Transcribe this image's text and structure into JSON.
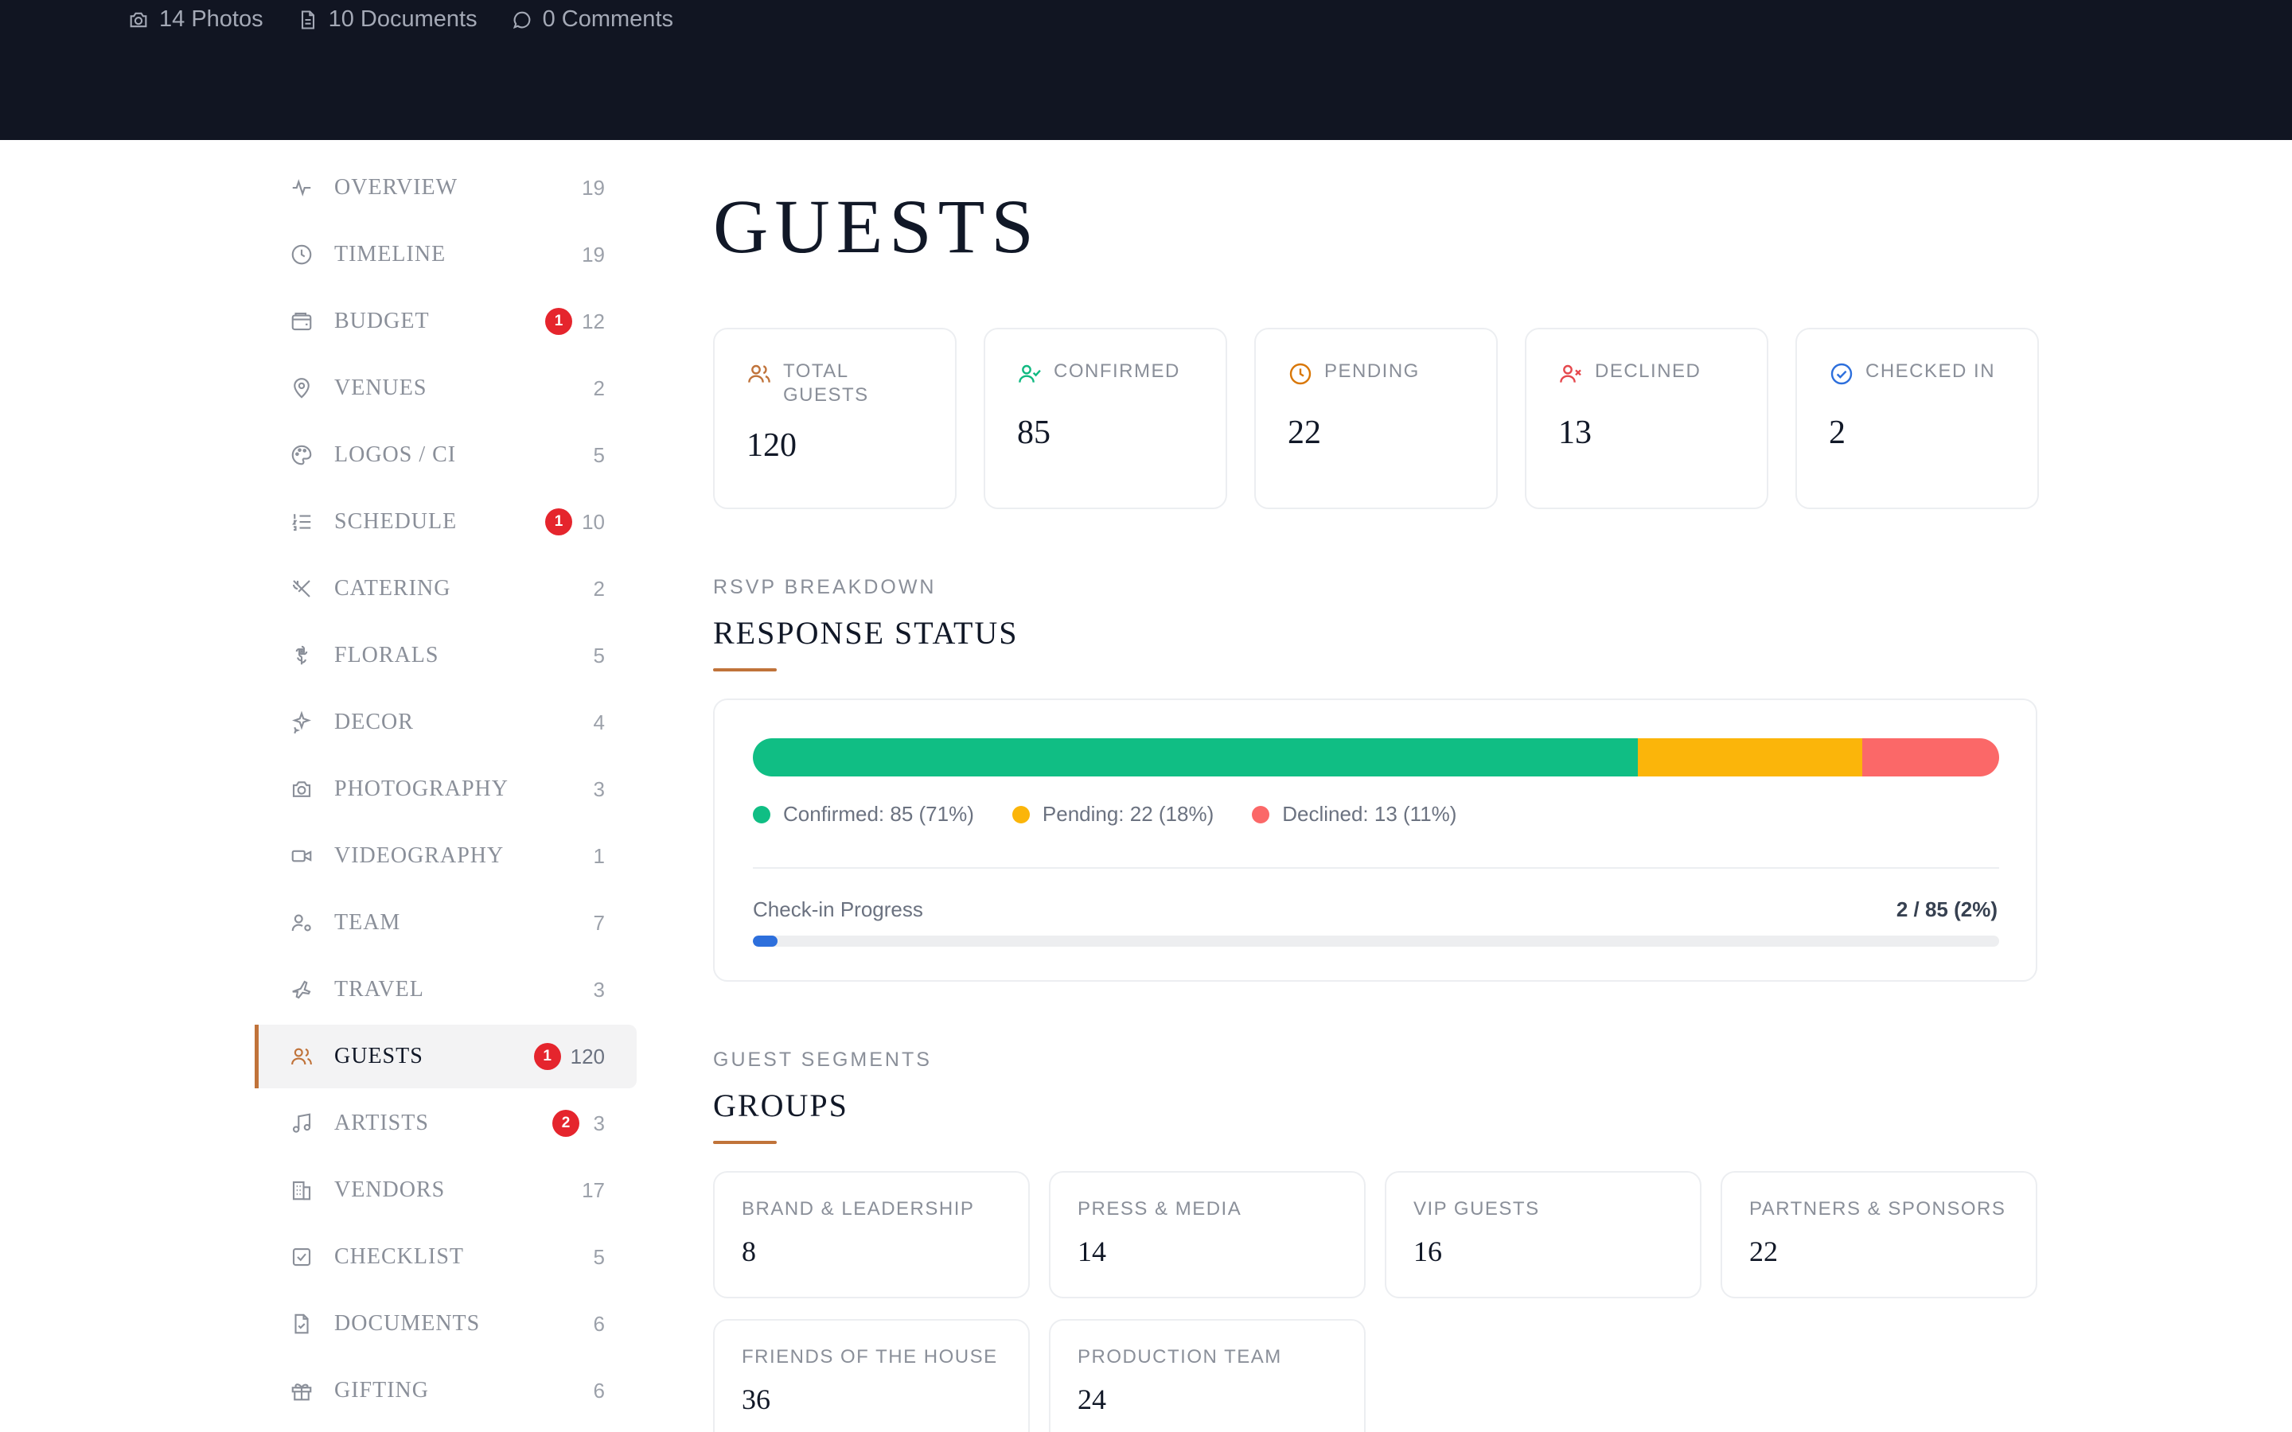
{
  "header": {
    "photos": "14 Photos",
    "documents": "10 Documents",
    "comments": "0 Comments"
  },
  "sidebar": {
    "items": [
      {
        "label": "OVERVIEW",
        "count": "19",
        "badge": "",
        "icon": "activity-icon"
      },
      {
        "label": "TIMELINE",
        "count": "19",
        "badge": "",
        "icon": "clock-icon"
      },
      {
        "label": "BUDGET",
        "count": "12",
        "badge": "1",
        "icon": "wallet-icon"
      },
      {
        "label": "VENUES",
        "count": "2",
        "badge": "",
        "icon": "map-pin-icon"
      },
      {
        "label": "LOGOS / CI",
        "count": "5",
        "badge": "",
        "icon": "palette-icon"
      },
      {
        "label": "SCHEDULE",
        "count": "10",
        "badge": "1",
        "icon": "list-ordered-icon"
      },
      {
        "label": "CATERING",
        "count": "2",
        "badge": "",
        "icon": "utensils-icon"
      },
      {
        "label": "FLORALS",
        "count": "5",
        "badge": "",
        "icon": "flower-icon"
      },
      {
        "label": "DECOR",
        "count": "4",
        "badge": "",
        "icon": "sparkles-icon"
      },
      {
        "label": "PHOTOGRAPHY",
        "count": "3",
        "badge": "",
        "icon": "camera-icon"
      },
      {
        "label": "VIDEOGRAPHY",
        "count": "1",
        "badge": "",
        "icon": "video-icon"
      },
      {
        "label": "TEAM",
        "count": "7",
        "badge": "",
        "icon": "user-cog-icon"
      },
      {
        "label": "TRAVEL",
        "count": "3",
        "badge": "",
        "icon": "plane-icon"
      },
      {
        "label": "GUESTS",
        "count": "120",
        "badge": "1",
        "icon": "users-icon",
        "active": true
      },
      {
        "label": "ARTISTS",
        "count": "3",
        "badge": "2",
        "icon": "music-icon"
      },
      {
        "label": "VENDORS",
        "count": "17",
        "badge": "",
        "icon": "building-icon"
      },
      {
        "label": "CHECKLIST",
        "count": "5",
        "badge": "",
        "icon": "check-square-icon"
      },
      {
        "label": "DOCUMENTS",
        "count": "6",
        "badge": "",
        "icon": "file-check-icon"
      },
      {
        "label": "GIFTING",
        "count": "6",
        "badge": "",
        "icon": "gift-icon"
      }
    ]
  },
  "page": {
    "title": "GUESTS"
  },
  "stats": {
    "total": {
      "label": "TOTAL GUESTS",
      "value": "120",
      "color": "#c0733a",
      "icon": "users-icon"
    },
    "confirmed": {
      "label": "CONFIRMED",
      "value": "85",
      "color": "#10b981",
      "icon": "user-check-icon"
    },
    "pending": {
      "label": "PENDING",
      "value": "22",
      "color": "#d97706",
      "icon": "clock-icon"
    },
    "declined": {
      "label": "DECLINED",
      "value": "13",
      "color": "#e5484d",
      "icon": "user-x-icon"
    },
    "checked_in": {
      "label": "CHECKED IN",
      "value": "2",
      "color": "#2d6fdc",
      "icon": "circle-check-icon"
    }
  },
  "rsvp": {
    "kicker": "RSVP BREAKDOWN",
    "title": "RESPONSE STATUS",
    "segments": [
      {
        "key": "confirmed",
        "fraction": 0.71,
        "color": "#10be84"
      },
      {
        "key": "pending",
        "fraction": 0.18,
        "color": "#fbb50a"
      },
      {
        "key": "declined",
        "fraction": 0.11,
        "color": "#fb6868"
      }
    ],
    "legend": {
      "confirmed": "Confirmed: 85 (71%)",
      "pending": "Pending: 22 (18%)",
      "declined": "Declined: 13 (11%)"
    },
    "checkin_label": "Check-in Progress",
    "checkin_value": "2 / 85 (2%)",
    "checkin_fraction": 0.02,
    "checkin_color": "#2d6fdc"
  },
  "groups": {
    "kicker": "GUEST SEGMENTS",
    "title": "GROUPS",
    "items": [
      {
        "label": "BRAND & LEADERSHIP",
        "value": "8"
      },
      {
        "label": "PRESS & MEDIA",
        "value": "14"
      },
      {
        "label": "VIP GUESTS",
        "value": "16"
      },
      {
        "label": "PARTNERS & SPONSORS",
        "value": "22"
      },
      {
        "label": "FRIENDS OF THE HOUSE",
        "value": "36"
      },
      {
        "label": "PRODUCTION TEAM",
        "value": "24"
      }
    ]
  },
  "theme": {
    "accent": "#c0733a",
    "header_bg": "#111522",
    "badge": "#e5252d"
  }
}
